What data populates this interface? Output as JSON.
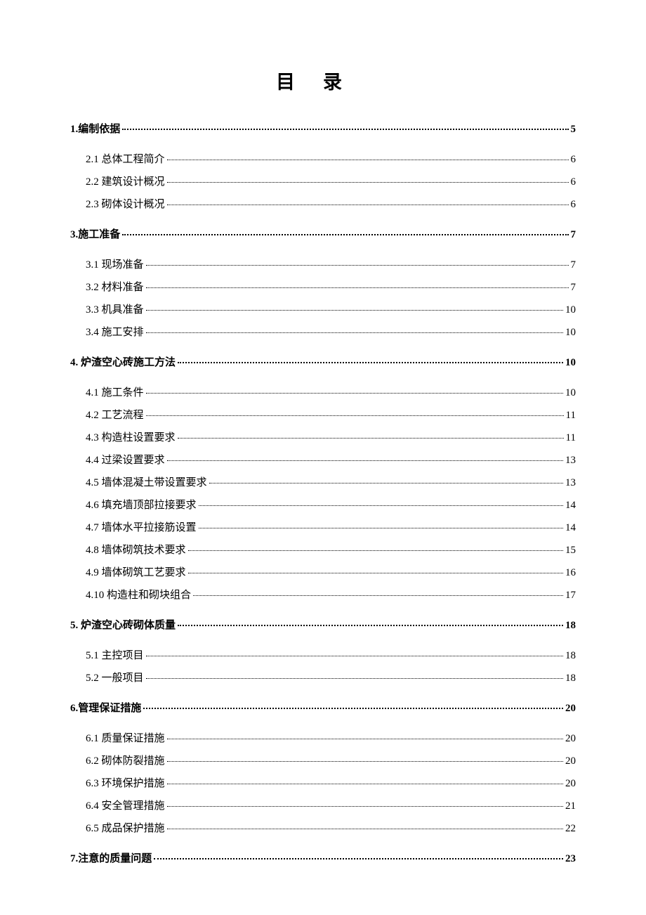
{
  "title": "目录",
  "toc": [
    {
      "level": 1,
      "label": "1.编制依据",
      "page": "5"
    },
    {
      "level": 2,
      "label": "2.1 总体工程简介",
      "page": "6"
    },
    {
      "level": 2,
      "label": "2.2 建筑设计概况",
      "page": "6"
    },
    {
      "level": 2,
      "label": "2.3 砌体设计概况",
      "page": "6"
    },
    {
      "level": 1,
      "label": "3.施工准备",
      "page": "7"
    },
    {
      "level": 2,
      "label": "3.1 现场准备",
      "page": "7"
    },
    {
      "level": 2,
      "label": "3.2 材料准备",
      "page": "7"
    },
    {
      "level": 2,
      "label": "3.3 机具准备",
      "page": "10"
    },
    {
      "level": 2,
      "label": "3.4 施工安排",
      "page": "10"
    },
    {
      "level": 1,
      "label": "4. 炉渣空心砖施工方法",
      "page": "10"
    },
    {
      "level": 2,
      "label": "4.1 施工条件",
      "page": "10"
    },
    {
      "level": 2,
      "label": "4.2 工艺流程",
      "page": "11"
    },
    {
      "level": 2,
      "label": "4.3 构造柱设置要求",
      "page": "11"
    },
    {
      "level": 2,
      "label": "4.4 过梁设置要求",
      "page": "13"
    },
    {
      "level": 2,
      "label": "4.5 墙体混凝土带设置要求",
      "page": "13"
    },
    {
      "level": 2,
      "label": "4.6 填充墙顶部拉接要求",
      "page": "14"
    },
    {
      "level": 2,
      "label": "4.7 墙体水平拉接筋设置",
      "page": "14"
    },
    {
      "level": 2,
      "label": "4.8 墙体砌筑技术要求",
      "page": "15"
    },
    {
      "level": 2,
      "label": "4.9 墙体砌筑工艺要求",
      "page": "16"
    },
    {
      "level": 2,
      "label": "4.10 构造柱和砌块组合",
      "page": "17"
    },
    {
      "level": 1,
      "label": "5. 炉渣空心砖砌体质量",
      "page": "18"
    },
    {
      "level": 2,
      "label": "5.1 主控项目",
      "page": "18"
    },
    {
      "level": 2,
      "label": "5.2 一般项目",
      "page": "18"
    },
    {
      "level": 1,
      "label": "6.管理保证措施",
      "page": "20"
    },
    {
      "level": 2,
      "label": "6.1 质量保证措施",
      "page": "20"
    },
    {
      "level": 2,
      "label": "6.2 砌体防裂措施",
      "page": "20"
    },
    {
      "level": 2,
      "label": "6.3 环境保护措施",
      "page": "20"
    },
    {
      "level": 2,
      "label": "6.4 安全管理措施",
      "page": "21"
    },
    {
      "level": 2,
      "label": "6.5 成品保护措施",
      "page": "22"
    },
    {
      "level": 1,
      "label": "7.注意的质量问题",
      "page": "23"
    }
  ]
}
